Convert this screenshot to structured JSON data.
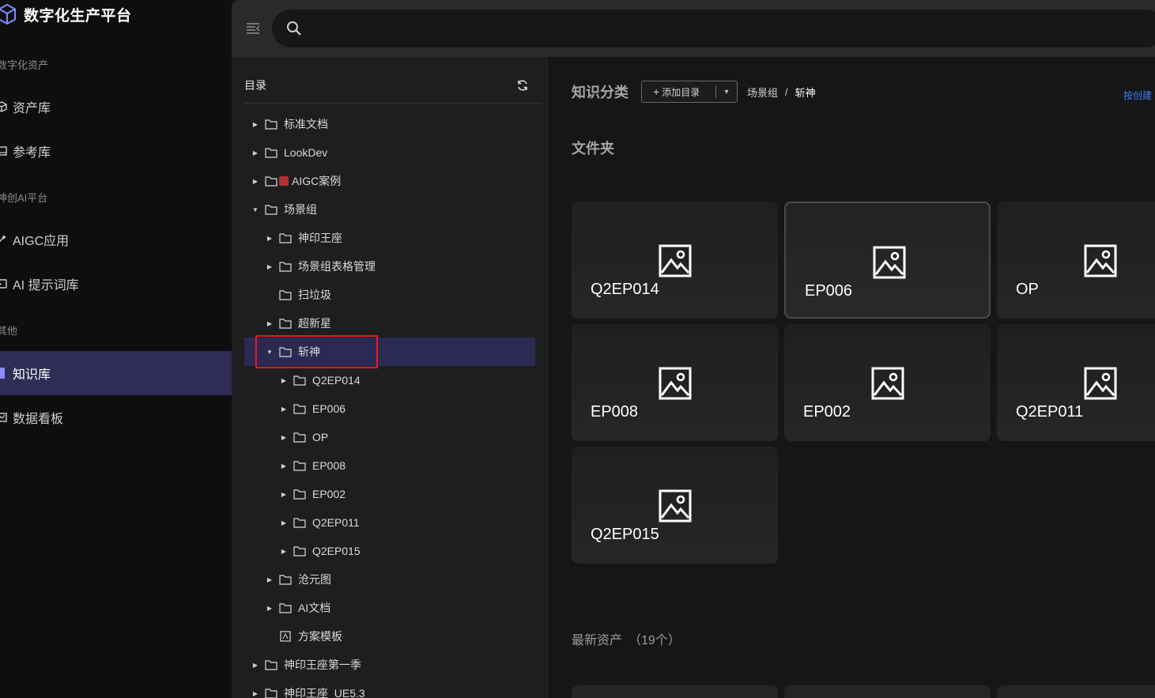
{
  "app": {
    "title": "数字化生产平台"
  },
  "nav": {
    "groups": [
      {
        "label": "数字化资产"
      },
      {
        "label": "神创AI平台"
      },
      {
        "label": "其他"
      }
    ],
    "items": [
      {
        "label": "资产库",
        "icon": "cube-icon"
      },
      {
        "label": "参考库",
        "icon": "book-icon"
      },
      {
        "label": "AIGC应用",
        "icon": "magic-icon"
      },
      {
        "label": "AI 提示词库",
        "icon": "prompt-icon"
      },
      {
        "label": "知识库",
        "icon": "knowledge-icon"
      },
      {
        "label": "数据看板",
        "icon": "chart-icon"
      }
    ]
  },
  "search": {
    "placeholder": "",
    "value": ""
  },
  "tree": {
    "title": "目录",
    "rows": [
      {
        "label": "标准文档"
      },
      {
        "label": "LookDev"
      },
      {
        "label": "AIGC案例"
      },
      {
        "label": "场景组"
      },
      {
        "label": "神印王座"
      },
      {
        "label": "场景组表格管理"
      },
      {
        "label": "扫垃圾"
      },
      {
        "label": "超新星"
      },
      {
        "label": "斩神"
      },
      {
        "label": "Q2EP014"
      },
      {
        "label": "EP006"
      },
      {
        "label": "OP"
      },
      {
        "label": "EP008"
      },
      {
        "label": "EP002"
      },
      {
        "label": "Q2EP011"
      },
      {
        "label": "Q2EP015"
      },
      {
        "label": "沧元图"
      },
      {
        "label": "AI文档"
      },
      {
        "label": "方案模板"
      },
      {
        "label": "神印王座第一季"
      },
      {
        "label": "神印王座_UE5.3"
      }
    ]
  },
  "main": {
    "section_title": "知识分类",
    "add_button": "添加目录",
    "breadcrumb": [
      "场景组",
      "斩神"
    ],
    "right_link": "按创建",
    "folder_title": "文件夹",
    "folders": [
      "Q2EP014",
      "EP006",
      "OP",
      "EP008",
      "EP002",
      "Q2EP011",
      "Q2EP015"
    ],
    "latest_title": "最新资产",
    "latest_count": "（19个）"
  },
  "colors": {
    "accent": "#2f2d56",
    "highlight_box": "#e21b1b",
    "link": "#3b7cff"
  }
}
